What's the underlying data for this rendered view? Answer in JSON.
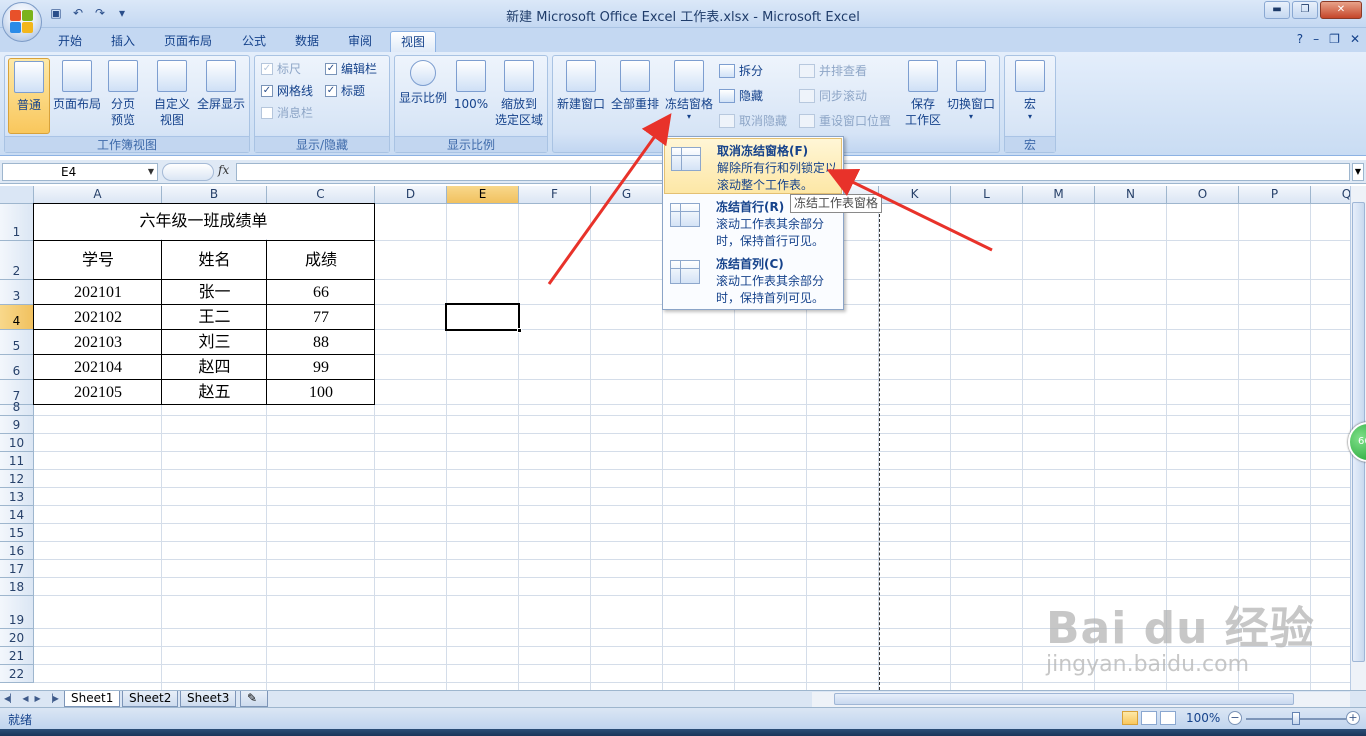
{
  "window": {
    "title": "新建 Microsoft Office Excel 工作表.xlsx - Microsoft Excel",
    "controls": [
      "minimize",
      "maximize",
      "close"
    ]
  },
  "ribbon_tabs": [
    "开始",
    "插入",
    "页面布局",
    "公式",
    "数据",
    "审阅",
    "视图"
  ],
  "active_tab": "视图",
  "ribbon": {
    "workbook_views": {
      "label": "工作簿视图",
      "normal": "普通",
      "page_layout": "页面布局",
      "page_break_l1": "分页",
      "page_break_l2": "预览",
      "custom_l1": "自定义",
      "custom_l2": "视图",
      "fullscreen": "全屏显示"
    },
    "show_hide": {
      "label": "显示/隐藏",
      "ruler": "标尺",
      "gridlines": "网格线",
      "message_bar": "消息栏",
      "formula_bar": "编辑栏",
      "headings": "标题"
    },
    "zoom": {
      "label": "显示比例",
      "zoom": "显示比例",
      "hundred": "100%",
      "to_selection_l1": "缩放到",
      "to_selection_l2": "选定区域"
    },
    "window": {
      "new_window": "新建窗口",
      "arrange_all": "全部重排",
      "freeze_panes": "冻结窗格",
      "split": "拆分",
      "hide": "隐藏",
      "unhide": "取消隐藏",
      "side_by_side": "并排查看",
      "sync_scroll": "同步滚动",
      "reset_position": "重设窗口位置",
      "save_ws_l1": "保存",
      "save_ws_l2": "工作区",
      "switch_windows": "切换窗口"
    },
    "macros": {
      "label": "宏",
      "macros": "宏"
    }
  },
  "formula_bar": {
    "name_box": "E4",
    "fx": "fx",
    "formula": ""
  },
  "columns": [
    "A",
    "B",
    "C",
    "D",
    "E",
    "F",
    "G",
    "H",
    "I",
    "J",
    "K",
    "L",
    "M",
    "N",
    "O",
    "P",
    "Q"
  ],
  "rows": [
    "1",
    "2",
    "3",
    "4",
    "5",
    "6",
    "7",
    "8",
    "9",
    "10",
    "11",
    "12",
    "13",
    "14",
    "15",
    "16",
    "17",
    "18",
    "19",
    "20",
    "21",
    "22"
  ],
  "selected_cell": "E4",
  "sheet": {
    "title": "六年级一班成绩单",
    "headers": [
      "学号",
      "姓名",
      "成绩"
    ],
    "records": [
      [
        "202101",
        "张一",
        "66"
      ],
      [
        "202102",
        "王二",
        "77"
      ],
      [
        "202103",
        "刘三",
        "88"
      ],
      [
        "202104",
        "赵四",
        "99"
      ],
      [
        "202105",
        "赵五",
        "100"
      ]
    ]
  },
  "freeze_menu": {
    "items": [
      {
        "title": "取消冻结窗格(F)",
        "desc": "解除所有行和列锁定以滚动整个工作表。"
      },
      {
        "title": "冻结首行(R)",
        "desc": "滚动工作表其余部分时，保持首行可见。"
      },
      {
        "title": "冻结首列(C)",
        "desc": "滚动工作表其余部分时，保持首列可见。"
      }
    ],
    "tooltip": "冻结工作表窗格"
  },
  "sheet_tabs": [
    "Sheet1",
    "Sheet2",
    "Sheet3"
  ],
  "active_sheet": "Sheet1",
  "status": {
    "ready": "就绪",
    "zoom": "100%",
    "zoom_fraction": 0.5
  },
  "side_badge": "66",
  "watermark": {
    "brand": "Bai du 经验",
    "url": "jingyan.baidu.com"
  },
  "colors": {
    "ribbon_bg": "#c9dcf3",
    "accent_blue": "#15428b",
    "selected_header": "#f1c15f",
    "annotation_arrow": "#e8322a"
  }
}
